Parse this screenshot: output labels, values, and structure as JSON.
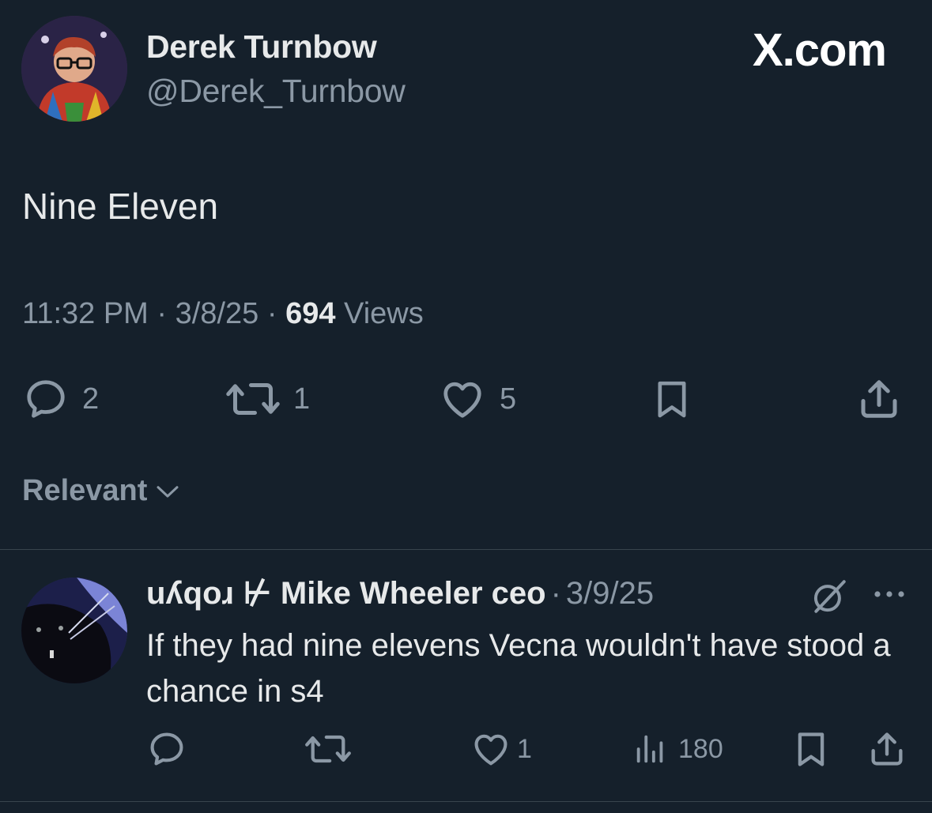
{
  "tweet": {
    "author_name": "Derek Turnbow",
    "author_handle": "@Derek_Turnbow",
    "brand": "X.com",
    "text": "Nine Eleven",
    "time": "11:32 PM",
    "date": "3/8/25",
    "views_count": "694",
    "views_label": "Views",
    "replies": "2",
    "reposts": "1",
    "likes": "5"
  },
  "sort": {
    "label": "Relevant"
  },
  "reply": {
    "author_name": "uʎqoɹ ⊬ Mike Wheeler ceo",
    "date": "3/9/25",
    "text": "If they had nine elevens Vecna wouldn't have stood a chance in s4",
    "likes": "1",
    "views": "180"
  },
  "colors": {
    "background": "#15202b",
    "text": "#e7e9ea",
    "muted": "#8b98a5",
    "divider": "#38444d"
  },
  "icons": [
    "reply-icon",
    "repost-icon",
    "like-icon",
    "bookmark-icon",
    "share-icon",
    "chevron-down-icon",
    "grok-icon",
    "more-icon",
    "views-icon"
  ]
}
